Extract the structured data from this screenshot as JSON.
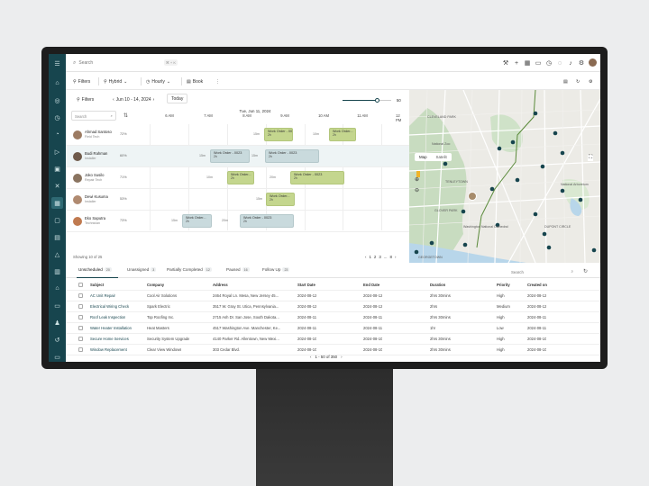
{
  "search": {
    "placeholder": "Search",
    "shortcut": "⌘ + K"
  },
  "toolbar": {
    "filters_label": "Filters",
    "hybrid_label": "Hybrid",
    "hourly_label": "Hourly",
    "book_label": "Book"
  },
  "schedule": {
    "filters_label": "Filters",
    "date_range": "Jun 10 - 14, 2024",
    "today_label": "Today",
    "zoom_value": "50",
    "zoom_fraction": 0.7,
    "day_label": "Tue, Jun 11, 2024",
    "search_placeholder": "Search",
    "time_labels": [
      "6 AM",
      "7 AM",
      "8 AM",
      "9 AM",
      "10 AM",
      "11 AM",
      "12 PM"
    ],
    "technicians": [
      {
        "name": "Ahmad Santoso",
        "role": "Field Tech",
        "pct": "72%",
        "color": "#9c7b62"
      },
      {
        "name": "Budi Rahman",
        "role": "Installer",
        "pct": "60%",
        "color": "#6f5a4b"
      },
      {
        "name": "Joko Susilo",
        "role": "Repair Tech",
        "pct": "71%",
        "color": "#8a7460"
      },
      {
        "name": "Dewi Kusuma",
        "role": "Installer",
        "pct": "53%",
        "color": "#b08a70"
      },
      {
        "name": "Eko Saputra",
        "role": "Technician",
        "pct": "73%",
        "color": "#c07a50"
      }
    ],
    "jobs": {
      "j1": {
        "title": "Work Order - 0023",
        "dur": "2h"
      },
      "j2": {
        "title": "Work Order...",
        "dur": "2h"
      },
      "j3": {
        "title": "Work Order - 0023",
        "dur": "2h"
      },
      "j4": {
        "title": "Work Order - 0023",
        "dur": "2h"
      },
      "j5": {
        "title": "Work Order...",
        "dur": "2h"
      },
      "j6": {
        "title": "Work Order - 0023",
        "dur": "2h"
      },
      "j7": {
        "title": "Work Order...",
        "dur": "2h"
      },
      "j8": {
        "title": "Work Order...",
        "dur": "2h"
      },
      "j9": {
        "title": "Work Order - 0023",
        "dur": "2h"
      },
      "j10": {
        "title": "Work Order...",
        "dur": "2h"
      }
    },
    "travel": {
      "t1": "15m",
      "t2": "10m",
      "t3": "15m",
      "t4": "15m",
      "t5": "10m",
      "t6": "20m",
      "t7": "15m",
      "t8": "15m",
      "t9": "20m"
    },
    "showing": "Showing 10 of 25",
    "pagination": [
      "1",
      "2",
      "3",
      "...",
      "8"
    ]
  },
  "map": {
    "map_tab": "Map",
    "satellite_tab": "Satelit",
    "labels": [
      "CLEVELAND PARK",
      "National Zoo",
      "TENLEYTOWN",
      "Washington National Cathedral",
      "GLOVER PARK",
      "DUPONT CIRCLE",
      "National Arboretum",
      "GEORGETOWN"
    ]
  },
  "table": {
    "tabs": [
      {
        "label": "Unscheduled",
        "count": "20"
      },
      {
        "label": "Unassigned",
        "count": "3"
      },
      {
        "label": "Partially Completed",
        "count": "12"
      },
      {
        "label": "Paused",
        "count": "16"
      },
      {
        "label": "Follow Up",
        "count": "23"
      }
    ],
    "search_placeholder": "Search",
    "columns": [
      "Subject",
      "Company",
      "Address",
      "Start Date",
      "End Date",
      "Duration",
      "Priority",
      "Created on"
    ],
    "rows": [
      [
        "AC Unit Repair",
        "Cool Air Solutions",
        "2464 Royal Ln. Mesa, New Jersey 45...",
        "2024-08-12",
        "2024-08-12",
        "2hrs 30mins",
        "High",
        "2024-08-12"
      ],
      [
        "Electrical Wiring Check",
        "Spark Electric",
        "3517 W. Gray St. Utica, Pennsylvania...",
        "2024-08-12",
        "2024-08-12",
        "2hrs",
        "Medium",
        "2024-08-12"
      ],
      [
        "Roof Leak Inspection",
        "Top Roofing Inc.",
        "2715 Ash Dr. San Jose, South Dakota...",
        "2024-08-11",
        "2024-08-11",
        "2hrs 30mins",
        "High",
        "2024-08-11"
      ],
      [
        "Water Heater Installation",
        "Heat Masters",
        "4517 Washington Ave. Manchester, Ke...",
        "2024-08-11",
        "2024-08-11",
        "1hr",
        "Low",
        "2024-08-11"
      ],
      [
        "Secure Home Services",
        "Security System Upgrade",
        "4140 Parker Rd. Allentown, New Mexi...",
        "2024-08-10",
        "2024-08-10",
        "2hrs 30mins",
        "High",
        "2024-08-10"
      ],
      [
        "Window Replacement",
        "Clear View Windows",
        "303 Cedar Blvd.",
        "2024-08-10",
        "2024-08-10",
        "2hrs 30mins",
        "High",
        "2024-08-10"
      ]
    ],
    "pagination": "1 - 50 of 350"
  }
}
